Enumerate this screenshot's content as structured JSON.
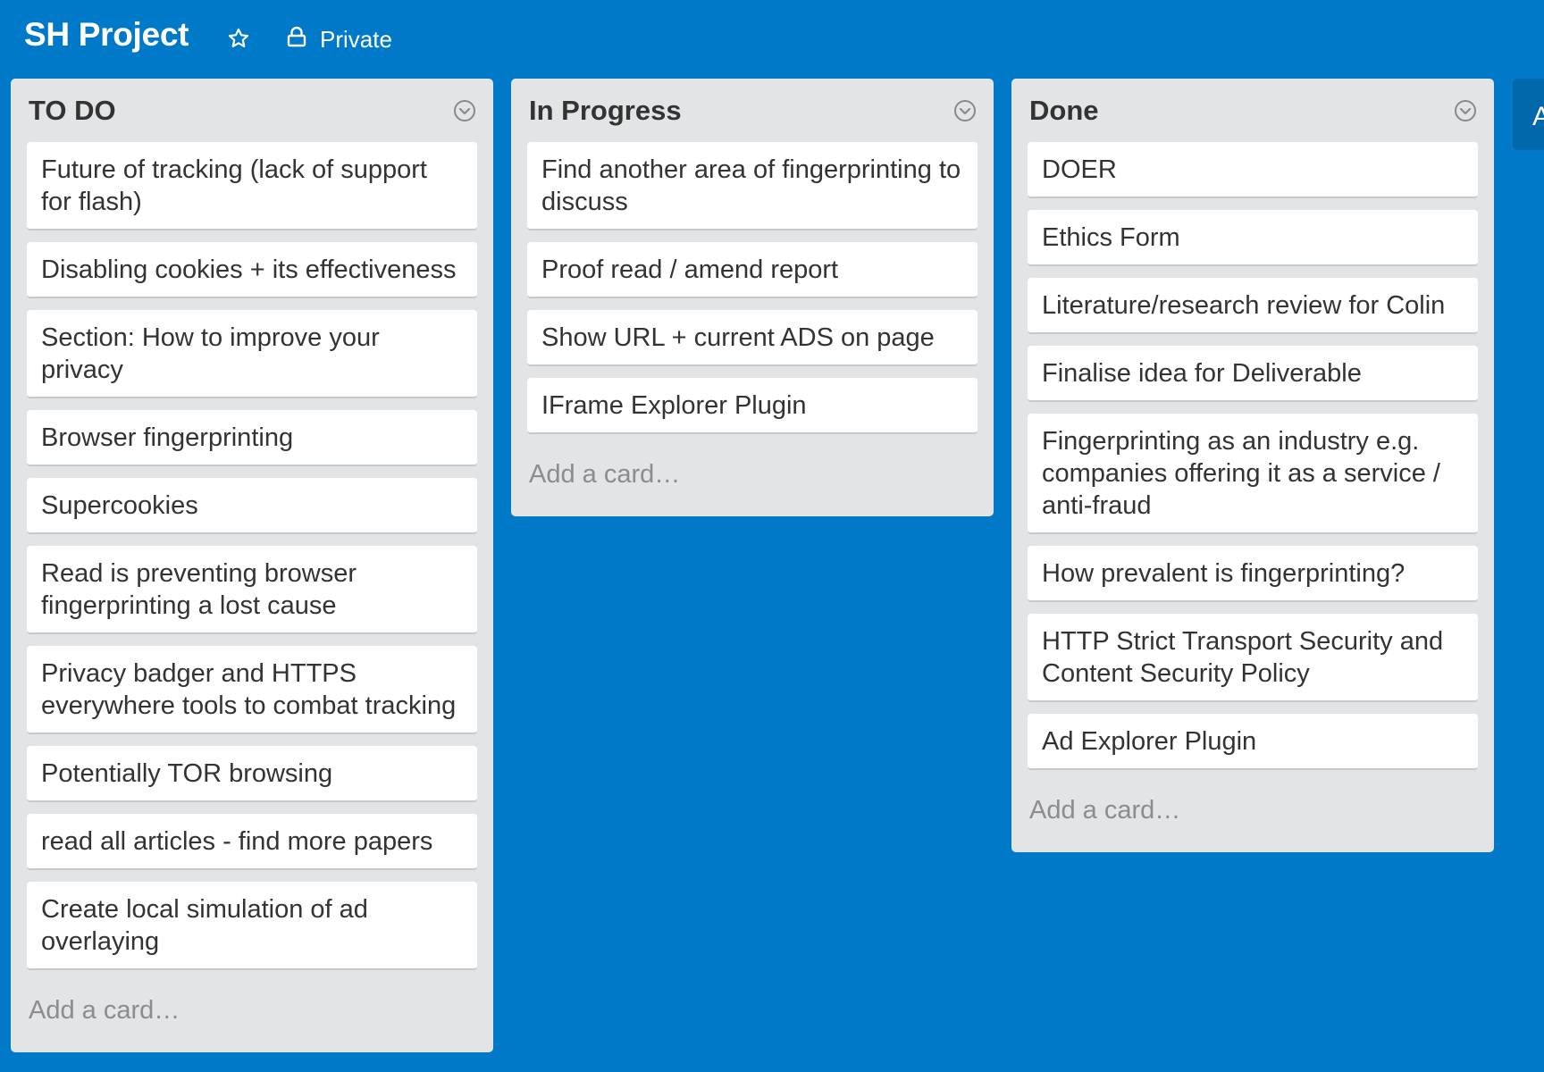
{
  "board": {
    "title": "SH Project",
    "visibility": "Private",
    "colors": {
      "background": "#0079c8",
      "list_background": "#e3e4e6",
      "card_background": "#ffffff",
      "text": "#333333",
      "muted_text": "#8c8c8c"
    }
  },
  "icons": {
    "star": "star-icon",
    "lock": "lock-icon",
    "list_menu": "chevron-down-circle-icon"
  },
  "lists": [
    {
      "title": "TO DO",
      "cards": [
        "Future of tracking (lack of support for flash)",
        "Disabling cookies + its effectiveness",
        "Section: How to improve your privacy",
        "Browser fingerprinting",
        "Supercookies",
        "Read is preventing browser fingerprinting a lost cause",
        "Privacy badger and HTTPS everywhere tools to combat tracking",
        "Potentially TOR browsing",
        "read all articles - find more papers",
        "Create local simulation of ad overlaying"
      ],
      "add_card_label": "Add a card…"
    },
    {
      "title": "In Progress",
      "cards": [
        "Find another area of fingerprinting to discuss",
        "Proof read / amend report",
        "Show URL + current ADS on page",
        "IFrame Explorer Plugin"
      ],
      "add_card_label": "Add a card…"
    },
    {
      "title": "Done",
      "cards": [
        "DOER",
        "Ethics Form",
        "Literature/research review for Colin",
        "Finalise idea for Deliverable",
        "Fingerprinting as an industry e.g. companies offering it as a service / anti-fraud",
        "How prevalent is fingerprinting?",
        "HTTP Strict Transport Security and Content Security Policy",
        "Ad Explorer Plugin"
      ],
      "add_card_label": "Add a card…"
    }
  ],
  "add_list_stub_label": "A"
}
